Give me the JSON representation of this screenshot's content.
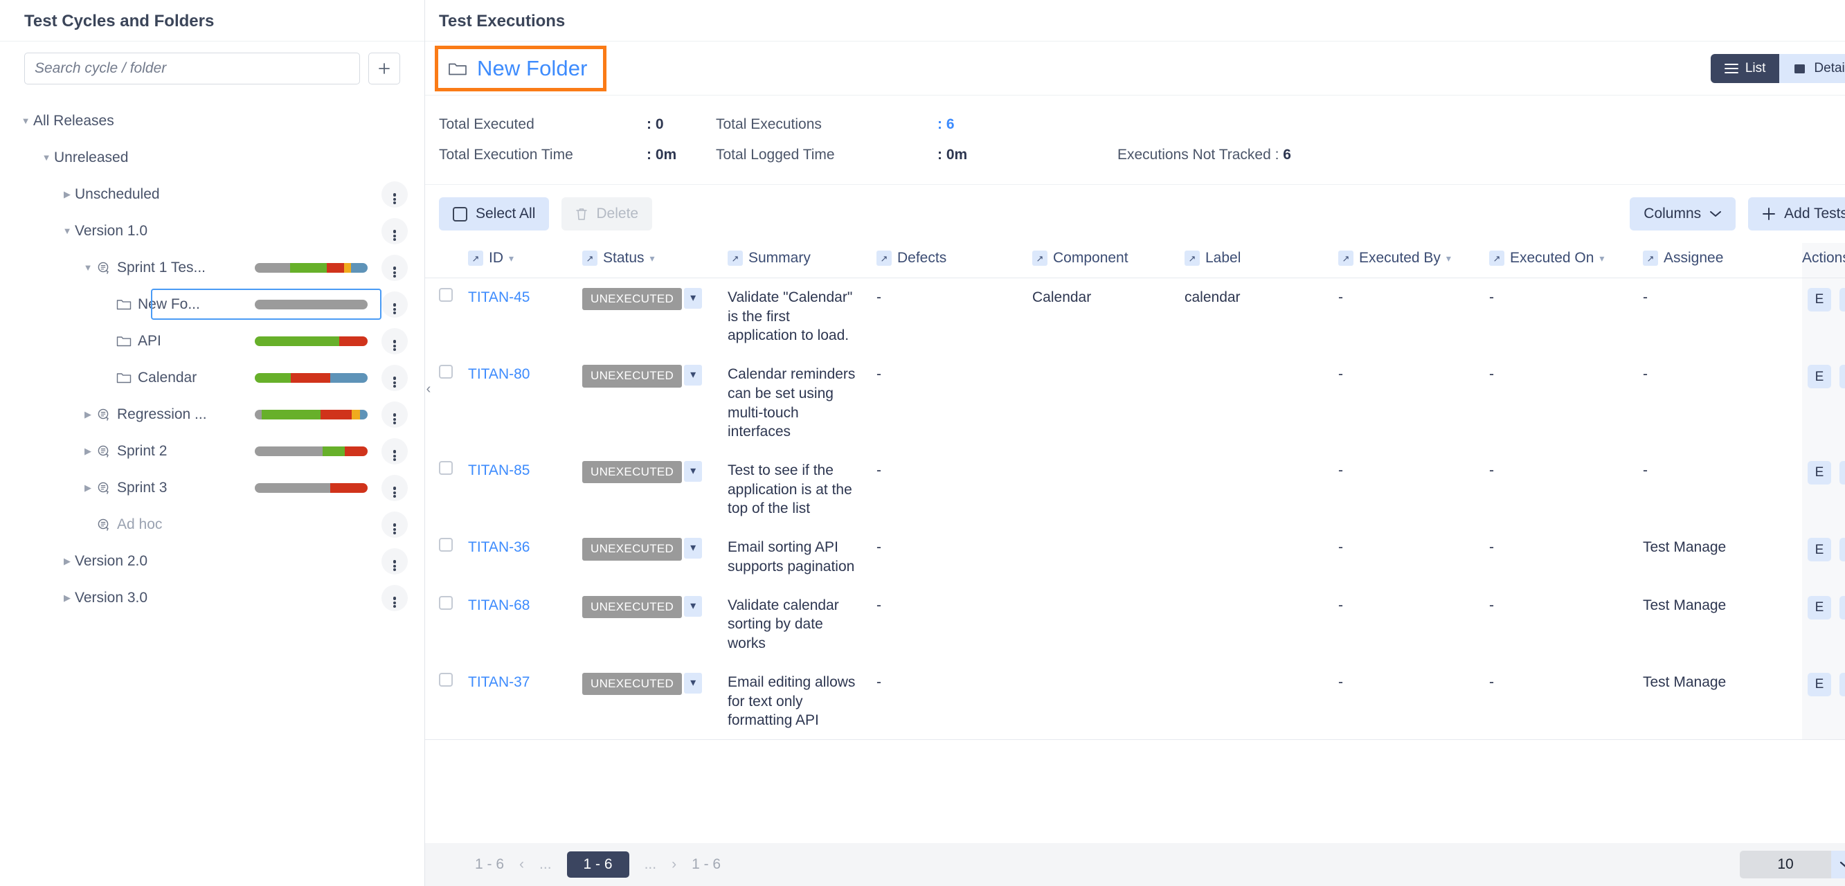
{
  "sidebar": {
    "title": "Test Cycles and Folders",
    "search": {
      "placeholder": "Search cycle / folder",
      "value": ""
    },
    "add_button_label": "+",
    "tree": [
      {
        "label": "All Releases",
        "indent": 0,
        "caret": "down",
        "icon": "none",
        "bar": null,
        "kebab": false,
        "selected": false,
        "muted": false
      },
      {
        "label": "Unreleased",
        "indent": 1,
        "caret": "down",
        "icon": "none",
        "bar": null,
        "kebab": false,
        "selected": false,
        "muted": false
      },
      {
        "label": "Unscheduled",
        "indent": 2,
        "caret": "right",
        "icon": "none",
        "bar": null,
        "kebab": true,
        "selected": false,
        "muted": false
      },
      {
        "label": "Version 1.0",
        "indent": 2,
        "caret": "down",
        "icon": "none",
        "bar": null,
        "kebab": true,
        "selected": false,
        "muted": false
      },
      {
        "label": "Sprint 1 Tes...",
        "indent": 3,
        "caret": "down",
        "icon": "cycle",
        "bar": [
          [
            "#9b9b9b",
            31
          ],
          [
            "#67b02a",
            33
          ],
          [
            "#d0331b",
            15
          ],
          [
            "#f0ab1e",
            6
          ],
          [
            "#5e93b8",
            15
          ]
        ],
        "kebab": true,
        "selected": false,
        "muted": false
      },
      {
        "label": "New Fo...",
        "indent": 4,
        "caret": "none",
        "icon": "folder",
        "bar": [
          [
            "#9b9b9b",
            100
          ]
        ],
        "kebab": true,
        "selected": true,
        "muted": false
      },
      {
        "label": "API",
        "indent": 4,
        "caret": "none",
        "icon": "folder",
        "bar": [
          [
            "#67b02a",
            75
          ],
          [
            "#d0331b",
            25
          ]
        ],
        "kebab": true,
        "selected": false,
        "muted": false
      },
      {
        "label": "Calendar",
        "indent": 4,
        "caret": "none",
        "icon": "folder",
        "bar": [
          [
            "#67b02a",
            32
          ],
          [
            "#d0331b",
            35
          ],
          [
            "#5e93b8",
            33
          ]
        ],
        "kebab": true,
        "selected": false,
        "muted": false
      },
      {
        "label": "Regression ...",
        "indent": 3,
        "caret": "right",
        "icon": "cycle",
        "bar": [
          [
            "#9b9b9b",
            6
          ],
          [
            "#67b02a",
            52
          ],
          [
            "#d0331b",
            28
          ],
          [
            "#f0ab1e",
            7
          ],
          [
            "#5e93b8",
            7
          ]
        ],
        "kebab": true,
        "selected": false,
        "muted": false
      },
      {
        "label": "Sprint 2",
        "indent": 3,
        "caret": "right",
        "icon": "cycle",
        "bar": [
          [
            "#9b9b9b",
            60
          ],
          [
            "#67b02a",
            20
          ],
          [
            "#d0331b",
            20
          ]
        ],
        "kebab": true,
        "selected": false,
        "muted": false
      },
      {
        "label": "Sprint 3",
        "indent": 3,
        "caret": "right",
        "icon": "cycle",
        "bar": [
          [
            "#9b9b9b",
            67
          ],
          [
            "#d0331b",
            33
          ]
        ],
        "kebab": true,
        "selected": false,
        "muted": false
      },
      {
        "label": "Ad hoc",
        "indent": 3,
        "caret": "none",
        "icon": "cycle",
        "bar": null,
        "kebab": true,
        "selected": false,
        "muted": true
      },
      {
        "label": "Version 2.0",
        "indent": 2,
        "caret": "right",
        "icon": "none",
        "bar": null,
        "kebab": true,
        "selected": false,
        "muted": false
      },
      {
        "label": "Version 3.0",
        "indent": 2,
        "caret": "right",
        "icon": "none",
        "bar": null,
        "kebab": true,
        "selected": false,
        "muted": false
      }
    ]
  },
  "main": {
    "title": "Test Executions",
    "folder": {
      "name": "New Folder",
      "icon": "folder-icon"
    },
    "view_toggle": {
      "list_label": "List",
      "detail_label": "Detail",
      "active": "List"
    },
    "stats": {
      "total_executed_label": "Total Executed",
      "total_executed_value": ": 0",
      "total_executions_label": "Total Executions",
      "total_executions_value": ": 6",
      "total_execution_time_label": "Total Execution Time",
      "total_execution_time_value": ": 0m",
      "total_logged_time_label": "Total Logged Time",
      "total_logged_time_value": ": 0m",
      "executions_not_tracked_label": "Executions Not Tracked :",
      "executions_not_tracked_value": "6"
    },
    "toolbar": {
      "select_all_label": "Select All",
      "delete_label": "Delete",
      "columns_label": "Columns",
      "add_tests_label": "Add Tests"
    },
    "table": {
      "headers": [
        {
          "label": "ID",
          "pin": true,
          "sort": true
        },
        {
          "label": "Status",
          "pin": true,
          "sort": true
        },
        {
          "label": "Summary",
          "pin": true,
          "sort": false
        },
        {
          "label": "Defects",
          "pin": true,
          "sort": false
        },
        {
          "label": "Component",
          "pin": true,
          "sort": false
        },
        {
          "label": "Label",
          "pin": true,
          "sort": false
        },
        {
          "label": "Executed By",
          "pin": true,
          "sort": true
        },
        {
          "label": "Executed On",
          "pin": true,
          "sort": true
        },
        {
          "label": "Assignee",
          "pin": true,
          "sort": false
        },
        {
          "label": "Actions",
          "pin": false,
          "sort": false
        }
      ],
      "rows": [
        {
          "id": "TITAN-45",
          "status": "UNEXECUTED",
          "summary": "Validate \"Calendar\" is the first application to load.",
          "defects": "-",
          "component": "Calendar",
          "label": "calendar",
          "executed_by": "-",
          "executed_on": "-",
          "assignee": "-",
          "actions": {
            "execute": "E",
            "delete": "delete-icon"
          }
        },
        {
          "id": "TITAN-80",
          "status": "UNEXECUTED",
          "summary": "Calendar reminders can be set using multi-touch interfaces",
          "defects": "-",
          "component": "",
          "label": "",
          "executed_by": "-",
          "executed_on": "-",
          "assignee": "-",
          "actions": {
            "execute": "E",
            "delete": "delete-icon"
          }
        },
        {
          "id": "TITAN-85",
          "status": "UNEXECUTED",
          "summary": "Test to see if the application is at the top of the list",
          "defects": "-",
          "component": "",
          "label": "",
          "executed_by": "-",
          "executed_on": "-",
          "assignee": "-",
          "actions": {
            "execute": "E",
            "delete": "delete-icon"
          }
        },
        {
          "id": "TITAN-36",
          "status": "UNEXECUTED",
          "summary": "Email sorting API supports pagination",
          "defects": "-",
          "component": "",
          "label": "",
          "executed_by": "-",
          "executed_on": "-",
          "assignee": "Test Manage",
          "actions": {
            "execute": "E",
            "delete": "delete-icon"
          }
        },
        {
          "id": "TITAN-68",
          "status": "UNEXECUTED",
          "summary": "Validate calendar sorting by date works",
          "defects": "-",
          "component": "",
          "label": "",
          "executed_by": "-",
          "executed_on": "-",
          "assignee": "Test Manage",
          "actions": {
            "execute": "E",
            "delete": "delete-icon"
          }
        },
        {
          "id": "TITAN-37",
          "status": "UNEXECUTED",
          "summary": "Email editing allows for text only formatting API",
          "defects": "-",
          "component": "",
          "label": "",
          "executed_by": "-",
          "executed_on": "-",
          "assignee": "Test Manage",
          "actions": {
            "execute": "E",
            "delete": "delete-icon"
          }
        }
      ]
    },
    "footer": {
      "range_left": "1 - 6",
      "prev_dots": "...",
      "current_page": "1 - 6",
      "next_dots": "...",
      "range_right": "1 - 6",
      "page_size": "10"
    }
  },
  "colors": {
    "accent_blue": "#3d8bfd",
    "highlight_orange": "#fa7b17",
    "dark_navy": "#3b4560",
    "pill_gray": "#9a9a9a"
  }
}
